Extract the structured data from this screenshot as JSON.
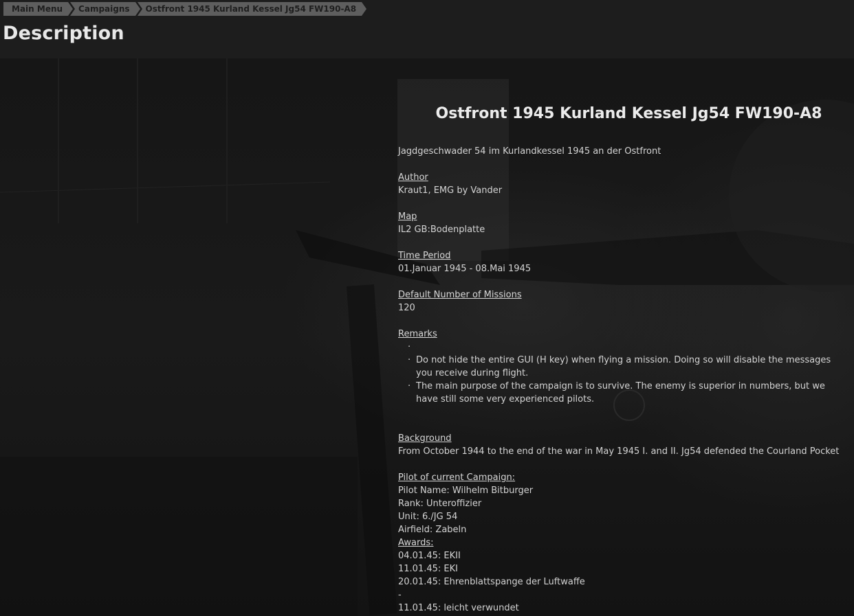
{
  "breadcrumb": {
    "items": [
      "Main Menu",
      "Campaigns",
      "Ostfront 1945 Kurland Kessel Jg54 FW190-A8"
    ]
  },
  "page_title": "Description",
  "campaign": {
    "title": "Ostfront 1945 Kurland Kessel Jg54 FW190-A8",
    "subtitle": "Jagdgeschwader 54 im Kurlandkessel 1945 an der Ostfront",
    "author_label": "Author",
    "author": "Kraut1, EMG by Vander",
    "map_label": "Map",
    "map": "IL2 GB:Bodenplatte",
    "time_label": "Time Period",
    "time": "01.Januar 1945 - 08.Mai 1945",
    "missions_label": "Default Number of Missions",
    "missions": "120",
    "remarks_label": "Remarks",
    "remarks": [
      "",
      "Do not hide the entire GUI (H key) when flying a mission. Doing so will disable the messages you receive during flight.",
      "The main purpose of the campaign is to survive. The enemy is superior in numbers, but we have still some very experienced pilots."
    ],
    "background_label": "Background",
    "background": "From October 1944 to the end of the war in May 1945 I. and II. Jg54 defended the Courland Pocket",
    "pilot_label": "Pilot of current Campaign:",
    "pilot_name": "Pilot Name: Wilhelm Bitburger",
    "rank": "Rank: Unteroffizier",
    "unit": "Unit: 6./JG 54",
    "airfield": "Airfield: Zabeln",
    "awards_label": "Awards:",
    "awards": [
      "04.01.45: EKII",
      "11.01.45: EKI",
      "20.01.45: Ehrenblattspange der Luftwaffe"
    ],
    "separator": "-",
    "wounds": [
      "11.01.45: leicht verwundet"
    ],
    "separator_end": "-"
  }
}
